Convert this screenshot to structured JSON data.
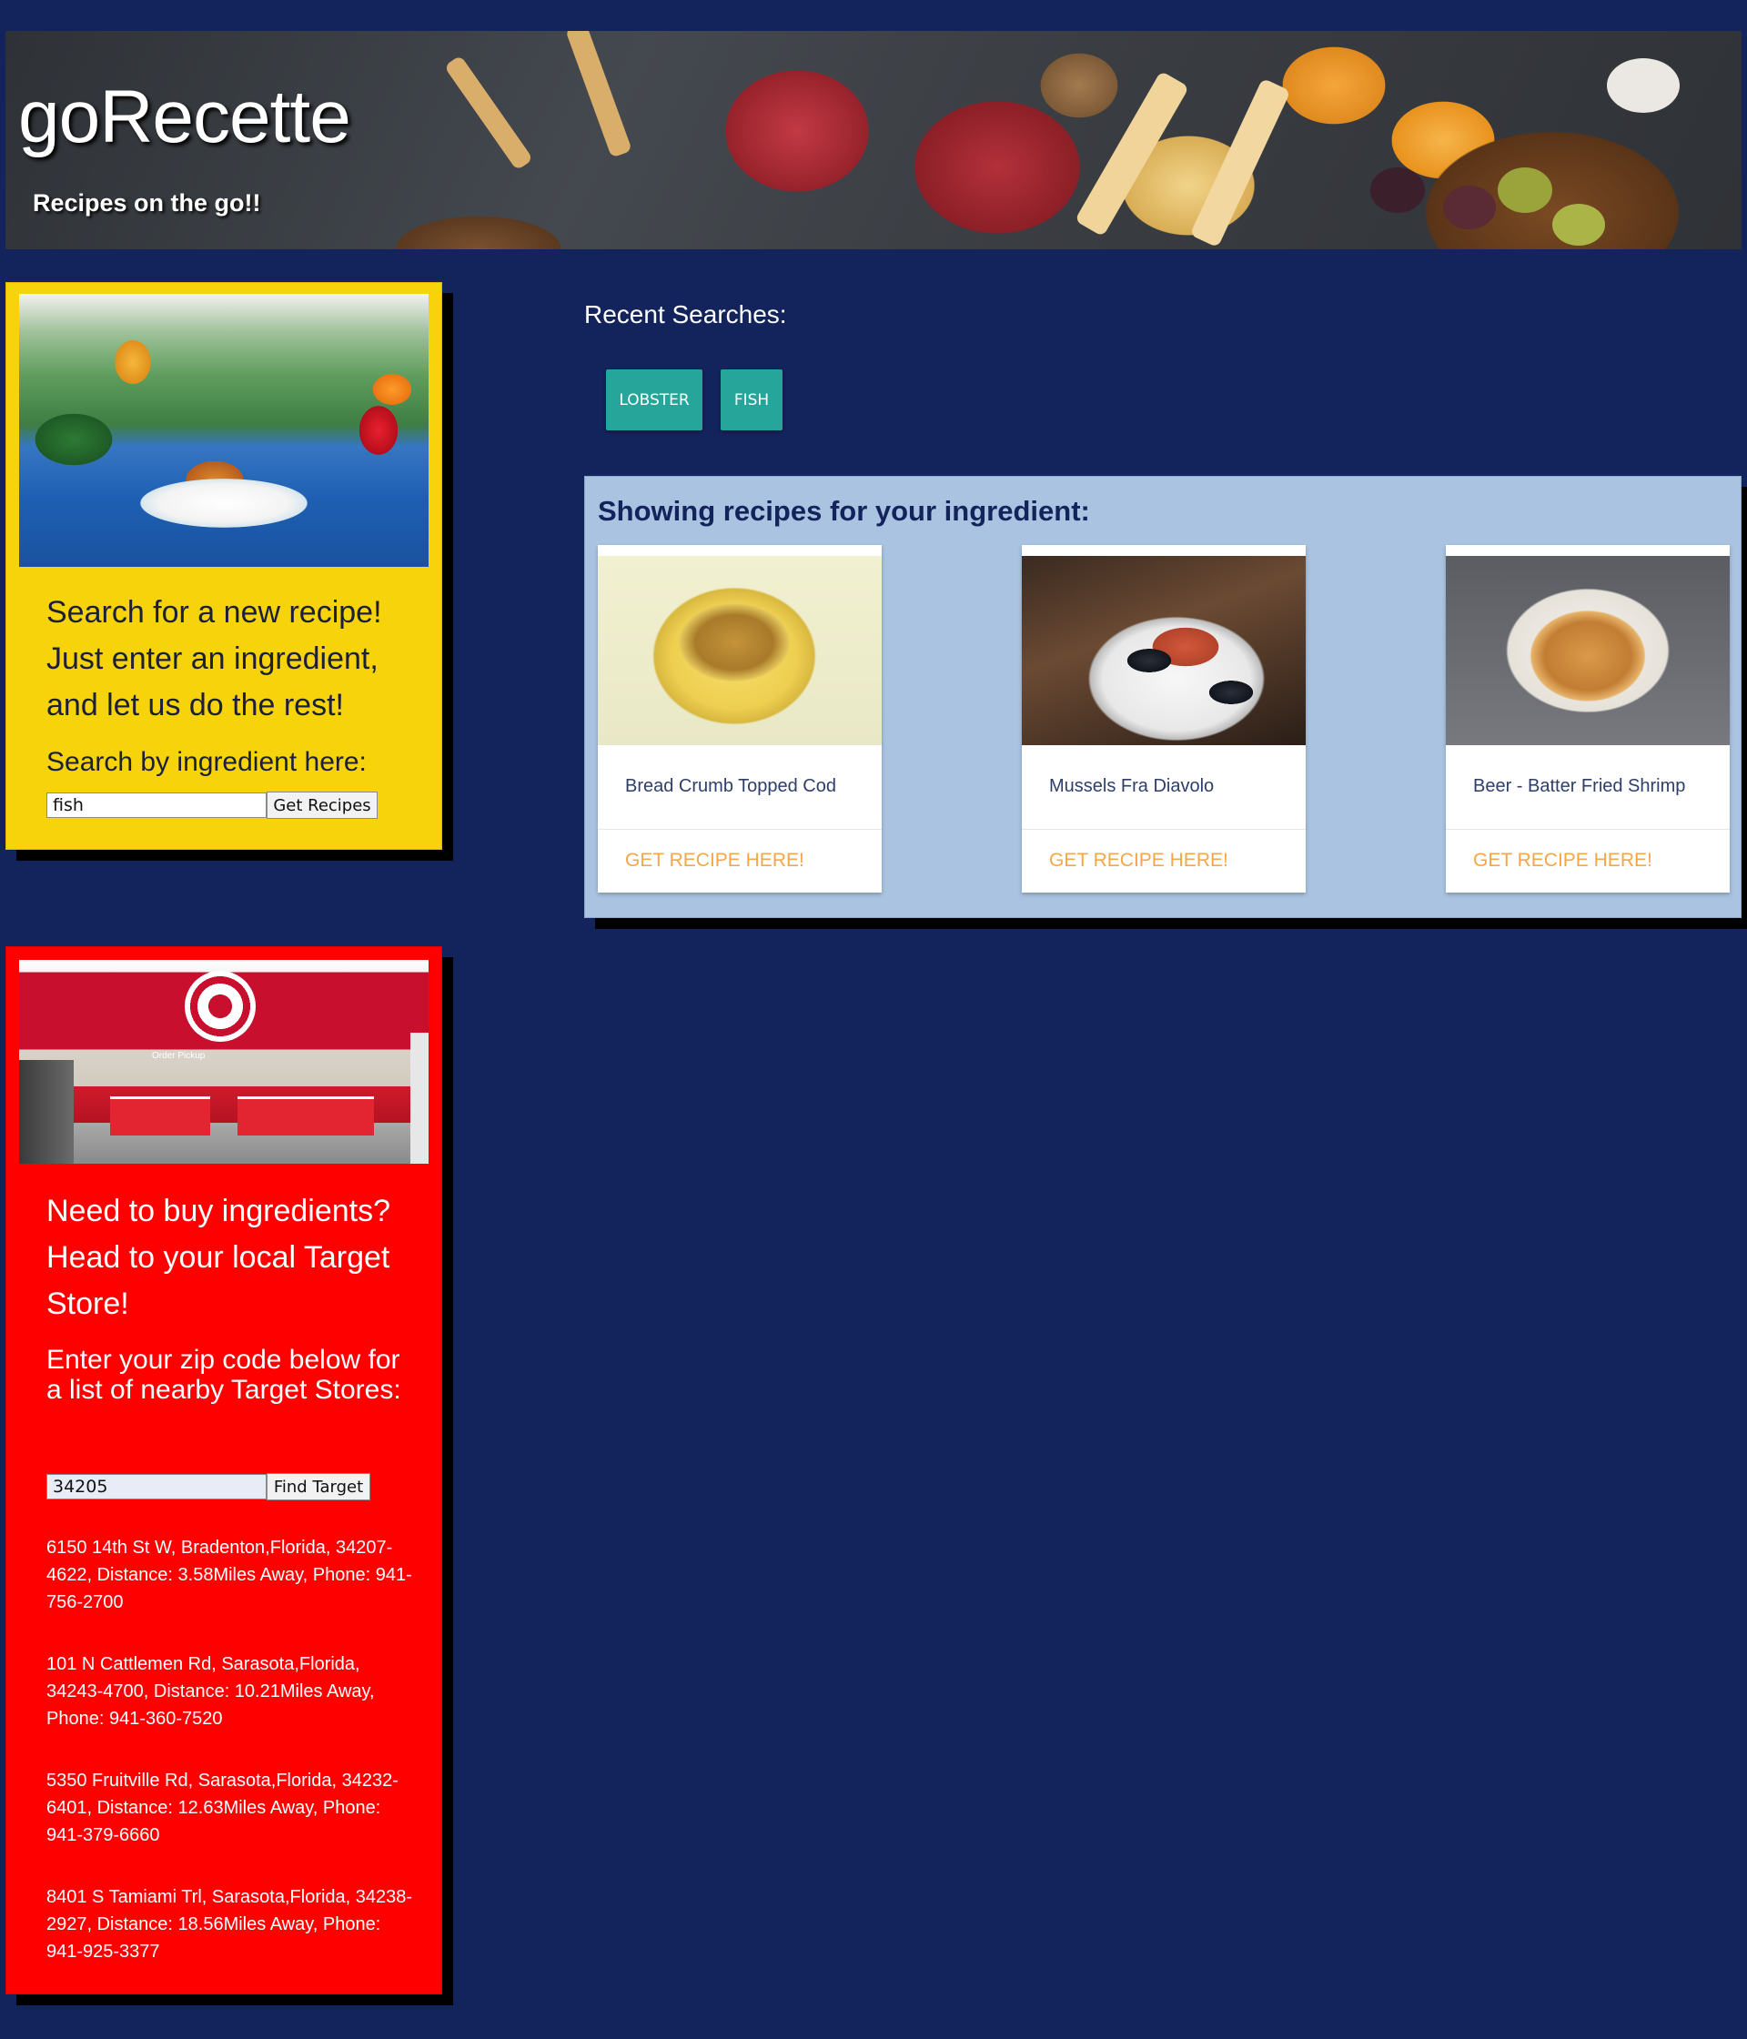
{
  "header": {
    "title": "goRecette",
    "tagline": "Recipes on the go!!"
  },
  "search_card": {
    "text": "Search for a new recipe! Just enter an ingredient, and let us do the rest!",
    "label": "Search by ingredient here:",
    "input_value": "fish",
    "button_label": "Get Recipes"
  },
  "recent": {
    "label": "Recent Searches:",
    "items": [
      "LOBSTER",
      "FISH"
    ]
  },
  "results": {
    "title": "Showing recipes for your ingredient:",
    "recipes": [
      {
        "name": "Bread Crumb Topped Cod",
        "link": "GET RECIPE HERE!"
      },
      {
        "name": "Mussels Fra Diavolo",
        "link": "GET RECIPE HERE!"
      },
      {
        "name": "Beer - Batter Fried Shrimp",
        "link": "GET RECIPE HERE!"
      }
    ]
  },
  "target_card": {
    "heading": "Need to buy ingredients? Head to your local Target Store!",
    "subheading": "Enter your zip code below for a list of nearby Target Stores:",
    "zip_value": "34205",
    "button_label": "Find Target",
    "photo_sign": "Order Pickup",
    "stores": [
      "6150 14th St W, Bradenton,Florida, 34207-4622, Distance: 3.58Miles Away, Phone: 941-756-2700",
      "101 N Cattlemen Rd, Sarasota,Florida, 34243-4700, Distance: 10.21Miles Away, Phone: 941-360-7520",
      "5350 Fruitville Rd, Sarasota,Florida, 34232-6401, Distance: 12.63Miles Away, Phone: 941-379-6660",
      "8401 S Tamiami Trl, Sarasota,Florida, 34238-2927, Distance: 18.56Miles Away, Phone: 941-925-3377"
    ]
  },
  "colors": {
    "page_background": "#13235b",
    "search_card": "#f6d30a",
    "target_card": "#fe0000",
    "recent_button": "#26a69a",
    "results_panel": "#a9c3e1",
    "recipe_link": "#f4a64a"
  }
}
